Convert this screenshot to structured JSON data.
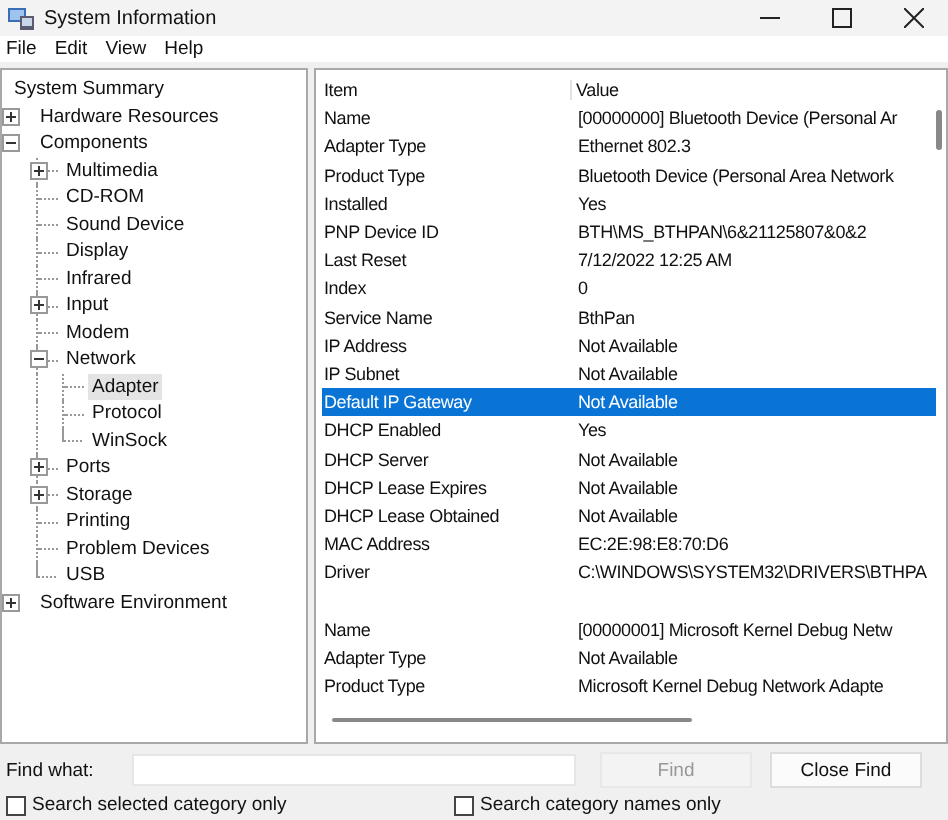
{
  "window": {
    "title": "System Information"
  },
  "menu": [
    {
      "label": "File"
    },
    {
      "label": "Edit"
    },
    {
      "label": "View"
    },
    {
      "label": "Help"
    }
  ],
  "tree": [
    {
      "label": "System Summary",
      "selected": false
    },
    {
      "label": "Hardware Resources",
      "expanded": false,
      "selected": false
    },
    {
      "label": "Components",
      "expanded": true,
      "selected": false,
      "children": [
        {
          "label": "Multimedia",
          "expanded": false,
          "selected": false
        },
        {
          "label": "CD-ROM",
          "selected": false
        },
        {
          "label": "Sound Device",
          "selected": false
        },
        {
          "label": "Display",
          "selected": false
        },
        {
          "label": "Infrared",
          "selected": false
        },
        {
          "label": "Input",
          "expanded": false,
          "selected": false
        },
        {
          "label": "Modem",
          "selected": false
        },
        {
          "label": "Network",
          "expanded": true,
          "selected": false,
          "children": [
            {
              "label": "Adapter",
              "selected": true
            },
            {
              "label": "Protocol",
              "selected": false
            },
            {
              "label": "WinSock",
              "selected": false
            }
          ]
        },
        {
          "label": "Ports",
          "expanded": false,
          "selected": false
        },
        {
          "label": "Storage",
          "expanded": false,
          "selected": false
        },
        {
          "label": "Printing",
          "selected": false
        },
        {
          "label": "Problem Devices",
          "selected": false
        },
        {
          "label": "USB",
          "selected": false
        }
      ]
    },
    {
      "label": "Software Environment",
      "expanded": false,
      "selected": false
    }
  ],
  "table": {
    "columns": [
      "Item",
      "Value"
    ],
    "groups": [
      {
        "rows": [
          {
            "item": "Name",
            "value": "[00000000] Bluetooth Device (Personal Ar",
            "selected": false
          },
          {
            "item": "Adapter Type",
            "value": "Ethernet 802.3",
            "selected": false
          },
          {
            "item": "Product Type",
            "value": "Bluetooth Device (Personal Area Network",
            "selected": false
          },
          {
            "item": "Installed",
            "value": "Yes",
            "selected": false
          },
          {
            "item": "PNP Device ID",
            "value": "BTH\\MS_BTHPAN\\6&21125807&0&2",
            "selected": false
          },
          {
            "item": "Last Reset",
            "value": "7/12/2022 12:25 AM",
            "selected": false
          },
          {
            "item": "Index",
            "value": "0",
            "selected": false
          },
          {
            "item": "Service Name",
            "value": "BthPan",
            "selected": false
          },
          {
            "item": "IP Address",
            "value": "Not Available",
            "selected": false
          },
          {
            "item": "IP Subnet",
            "value": "Not Available",
            "selected": false
          },
          {
            "item": "Default IP Gateway",
            "value": "Not Available",
            "selected": true
          },
          {
            "item": "DHCP Enabled",
            "value": "Yes",
            "selected": false
          },
          {
            "item": "DHCP Server",
            "value": "Not Available",
            "selected": false
          },
          {
            "item": "DHCP Lease Expires",
            "value": "Not Available",
            "selected": false
          },
          {
            "item": "DHCP Lease Obtained",
            "value": "Not Available",
            "selected": false
          },
          {
            "item": "MAC Address",
            "value": "EC:2E:98:E8:70:D6",
            "selected": false
          },
          {
            "item": "Driver",
            "value": "C:\\WINDOWS\\SYSTEM32\\DRIVERS\\BTHPA",
            "selected": false
          }
        ]
      },
      {
        "rows": [
          {
            "item": "Name",
            "value": "[00000001] Microsoft Kernel Debug Netw",
            "selected": false
          },
          {
            "item": "Adapter Type",
            "value": "Not Available",
            "selected": false
          },
          {
            "item": "Product Type",
            "value": "Microsoft Kernel Debug Network Adapte",
            "selected": false
          }
        ]
      }
    ]
  },
  "find": {
    "label": "Find what:",
    "find_button": {
      "label": "Find",
      "disabled": true
    },
    "close_button": {
      "label": "Close Find",
      "disabled": false
    },
    "checkboxes": [
      {
        "label": "Search selected category only",
        "checked": false
      },
      {
        "label": "Search category names only",
        "checked": false
      }
    ]
  }
}
